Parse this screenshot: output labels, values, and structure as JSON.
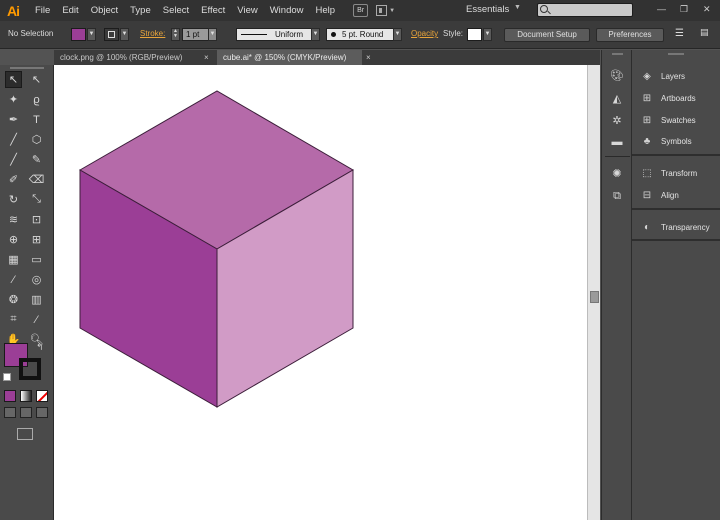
{
  "app": {
    "logo": "Ai",
    "workspace": "Essentials",
    "bridge_badge": "Br"
  },
  "menu": [
    "File",
    "Edit",
    "Object",
    "Type",
    "Select",
    "Effect",
    "View",
    "Window",
    "Help"
  ],
  "control_bar": {
    "selection": "No Selection",
    "stroke_label": "Stroke:",
    "stroke_weight": "1 pt",
    "profile": "Uniform",
    "brush": "5 pt. Round",
    "opacity_label": "Opacity",
    "style_label": "Style:",
    "document_setup": "Document Setup",
    "preferences": "Preferences"
  },
  "tabs": [
    {
      "label": "clock.png @ 100% (RGB/Preview)",
      "active": false
    },
    {
      "label": "cube.ai* @ 150% (CMYK/Preview)",
      "active": true
    }
  ],
  "panels": [
    {
      "label": "Layers",
      "icon": "layers-icon"
    },
    {
      "label": "Artboards",
      "icon": "artboards-icon"
    },
    {
      "label": "Swatches",
      "icon": "swatches-icon"
    },
    {
      "label": "Symbols",
      "icon": "symbols-icon"
    },
    {
      "label": "Transform",
      "icon": "transform-icon"
    },
    {
      "label": "Align",
      "icon": "align-icon"
    },
    {
      "label": "Transparency",
      "icon": "transparency-icon"
    }
  ],
  "colors": {
    "fill": "#9b3e96",
    "cube_top": "#b56aa9",
    "cube_left": "#9b3e96",
    "cube_right": "#d19bc6",
    "cube_edge": "#3c1e3a",
    "accent_orange": "#e8a43a"
  }
}
